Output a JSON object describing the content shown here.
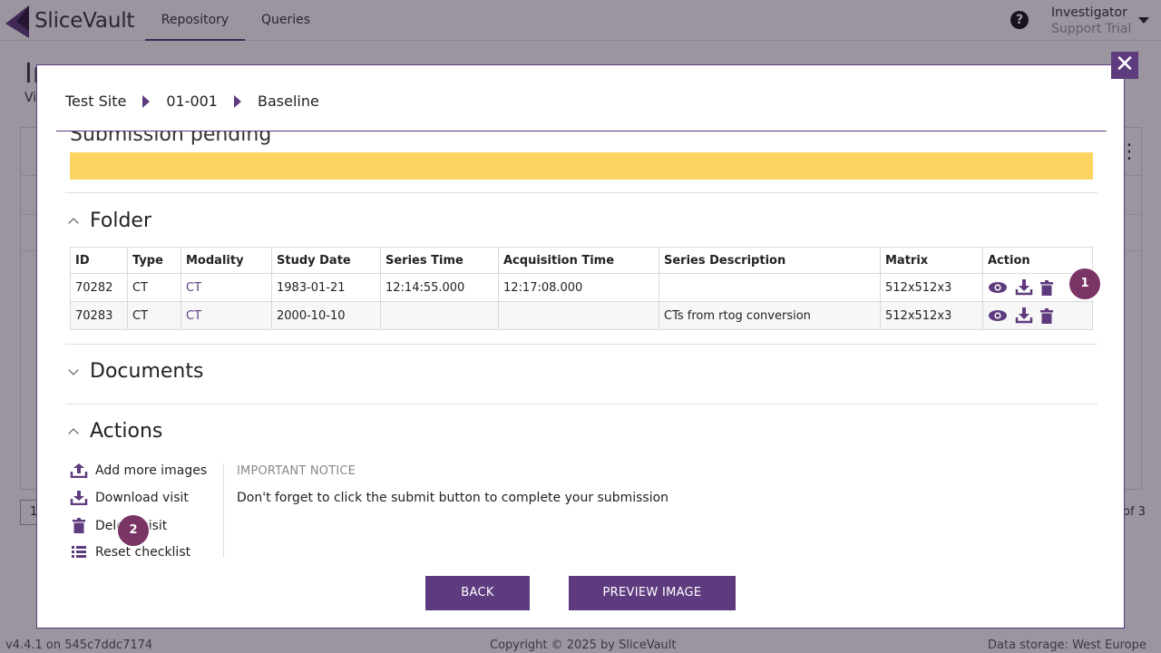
{
  "app": {
    "brand": "SliceVault",
    "nav": [
      {
        "label": "Repository"
      },
      {
        "label": "Queries"
      }
    ],
    "help_icon": "?",
    "user": {
      "name": "Investigator",
      "trial": "Support Trial"
    }
  },
  "background": {
    "title": "In",
    "subtitle": "Vi",
    "pager": "1",
    "of_pages": "of 3",
    "footer_version": "v4.4.1 on 545c7ddc7174",
    "footer_copyright": "Copyright © 2025 by SliceVault",
    "footer_storage": "Data storage: West Europe"
  },
  "modal": {
    "close_label": "✕",
    "breadcrumb": [
      "Test Site",
      "01-001",
      "Baseline"
    ],
    "status_text": "Submission pending",
    "status_color": "#fcd462",
    "sections": {
      "folder": "Folder",
      "documents": "Documents",
      "actions": "Actions"
    },
    "table": {
      "headers": [
        "ID",
        "Type",
        "Modality",
        "Study Date",
        "Series Time",
        "Acquisition Time",
        "Series Description",
        "Matrix",
        "Action"
      ],
      "rows": [
        {
          "id": "70282",
          "type": "CT",
          "modality": "CT",
          "study_date": "1983-01-21",
          "series_time": "12:14:55.000",
          "acq_time": "12:17:08.000",
          "desc": "",
          "matrix": "512x512x3"
        },
        {
          "id": "70283",
          "type": "CT",
          "modality": "CT",
          "study_date": "2000-10-10",
          "series_time": "",
          "acq_time": "",
          "desc": "CTs from rtog conversion",
          "matrix": "512x512x3"
        }
      ]
    },
    "actions": [
      {
        "label": "Add more images",
        "icon": "upload-icon"
      },
      {
        "label": "Download visit",
        "icon": "download-icon"
      },
      {
        "label": "Delete visit",
        "icon": "trash-icon"
      },
      {
        "label": "Reset checklist",
        "icon": "list-icon"
      }
    ],
    "notice_heading": "IMPORTANT NOTICE",
    "notice_text": "Don't forget to click the submit button to complete your submission",
    "buttons": {
      "back": "BACK",
      "preview": "PREVIEW IMAGE"
    }
  },
  "markers": [
    "1",
    "2"
  ],
  "colors": {
    "accent": "#5e3b7f",
    "marker": "#7a3466",
    "status": "#fcd462"
  }
}
